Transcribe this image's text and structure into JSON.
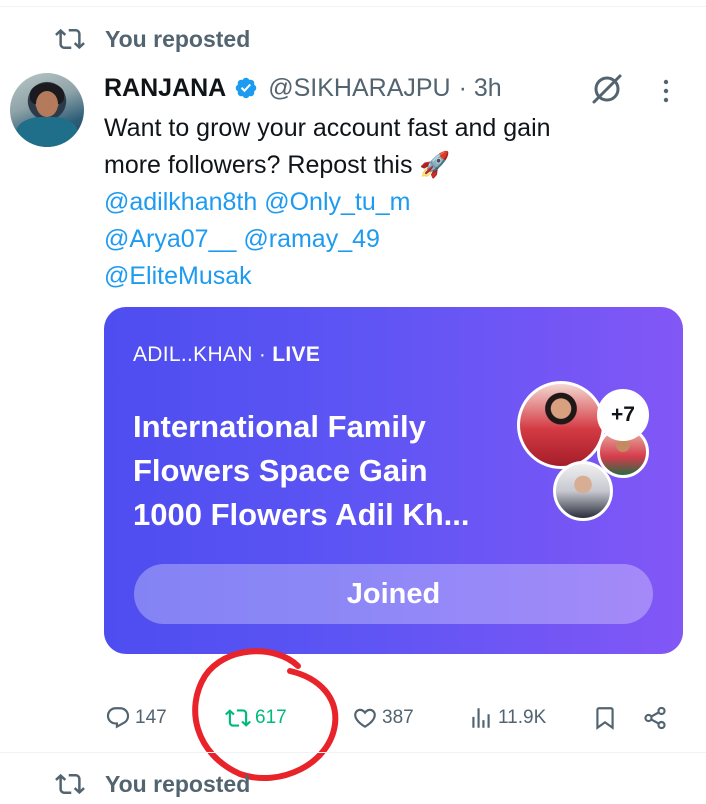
{
  "top_repost": {
    "label": "You reposted"
  },
  "tweet": {
    "author_name": "RANJANA",
    "handle": "@SIKHARAJPU",
    "time": "· 3h",
    "text_line1": "Want to grow your account fast and gain",
    "text_line2": "more followers? Repost this",
    "emoji": "🚀",
    "mentions": [
      "@adilkhan8th",
      "@Only_tu_m",
      "@Arya07__",
      "@ramay_49",
      "@EliteMusak"
    ]
  },
  "space_card": {
    "host": "ADIL..KHAN",
    "status_sep": " · ",
    "status": "LIVE",
    "title_lines": [
      "International Family",
      "Flowers Space Gain",
      "1000 Flowers Adil Kh..."
    ],
    "more_participants": "+7",
    "button_label": "Joined"
  },
  "actions": {
    "replies": "147",
    "reposts": "617",
    "likes": "387",
    "views": "11.9K"
  },
  "bottom_repost": {
    "label": "You reposted"
  },
  "colors": {
    "accent_blue": "#1d9bf0",
    "repost_green": "#00ba7c",
    "muted": "#536471",
    "card_start": "#4e4df0",
    "card_end": "#8257f6",
    "annotation_red": "#e8232a"
  },
  "icons": [
    "repost-icon",
    "verified-icon",
    "grok-icon",
    "more-icon",
    "reply-icon",
    "like-icon",
    "views-icon",
    "bookmark-icon",
    "share-icon"
  ]
}
